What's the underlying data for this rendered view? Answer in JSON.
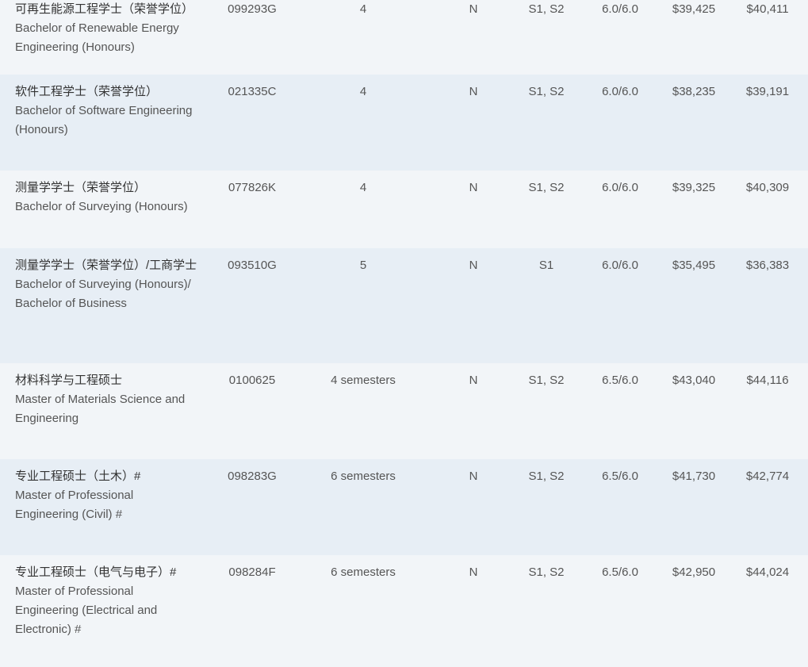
{
  "rows": [
    {
      "name_zh": "可再生能源工程学士（荣誉学位）",
      "name_en": "Bachelor of Renewable Energy Engineering (Honours)",
      "code": "099293G",
      "duration": "4",
      "flag": "N",
      "semesters": "S1, S2",
      "ielts": "6.0/6.0",
      "fee_a": "$39,425",
      "fee_b": "$40,411"
    },
    {
      "name_zh": "软件工程学士（荣誉学位）",
      "name_en": "Bachelor of Software Engineering (Honours)",
      "code": "021335C",
      "duration": "4",
      "flag": "N",
      "semesters": "S1, S2",
      "ielts": "6.0/6.0",
      "fee_a": "$38,235",
      "fee_b": "$39,191"
    },
    {
      "name_zh": "测量学学士（荣誉学位）",
      "name_en": "Bachelor of Surveying (Honours)",
      "code": "077826K",
      "duration": "4",
      "flag": "N",
      "semesters": "S1, S2",
      "ielts": "6.0/6.0",
      "fee_a": "$39,325",
      "fee_b": "$40,309"
    },
    {
      "name_zh": "测量学学士（荣誉学位）/工商学士",
      "name_en": "Bachelor of Surveying (Honours)/ Bachelor of Business",
      "code": "093510G",
      "duration": "5",
      "flag": "N",
      "semesters": "S1",
      "ielts": "6.0/6.0",
      "fee_a": "$35,495",
      "fee_b": "$36,383"
    },
    {
      "name_zh": "材料科学与工程硕士",
      "name_en": "Master of Materials Science and Engineering",
      "code": "0100625",
      "duration": "4 semesters",
      "flag": "N",
      "semesters": "S1, S2",
      "ielts": "6.5/6.0",
      "fee_a": "$43,040",
      "fee_b": "$44,116"
    },
    {
      "name_zh": "专业工程硕士（土木）#",
      "name_en": "Master of Professional Engineering (Civil) #",
      "code": "098283G",
      "duration": "6 semesters",
      "flag": "N",
      "semesters": "S1, S2",
      "ielts": "6.5/6.0",
      "fee_a": "$41,730",
      "fee_b": "$42,774"
    },
    {
      "name_zh": "专业工程硕士（电气与电子）#",
      "name_en": "Master of Professional Engineering (Electrical and Electronic) #",
      "code": "098284F",
      "duration": "6 semesters",
      "flag": "N",
      "semesters": "S1, S2",
      "ielts": "6.5/6.0",
      "fee_a": "$42,950",
      "fee_b": "$44,024"
    }
  ]
}
